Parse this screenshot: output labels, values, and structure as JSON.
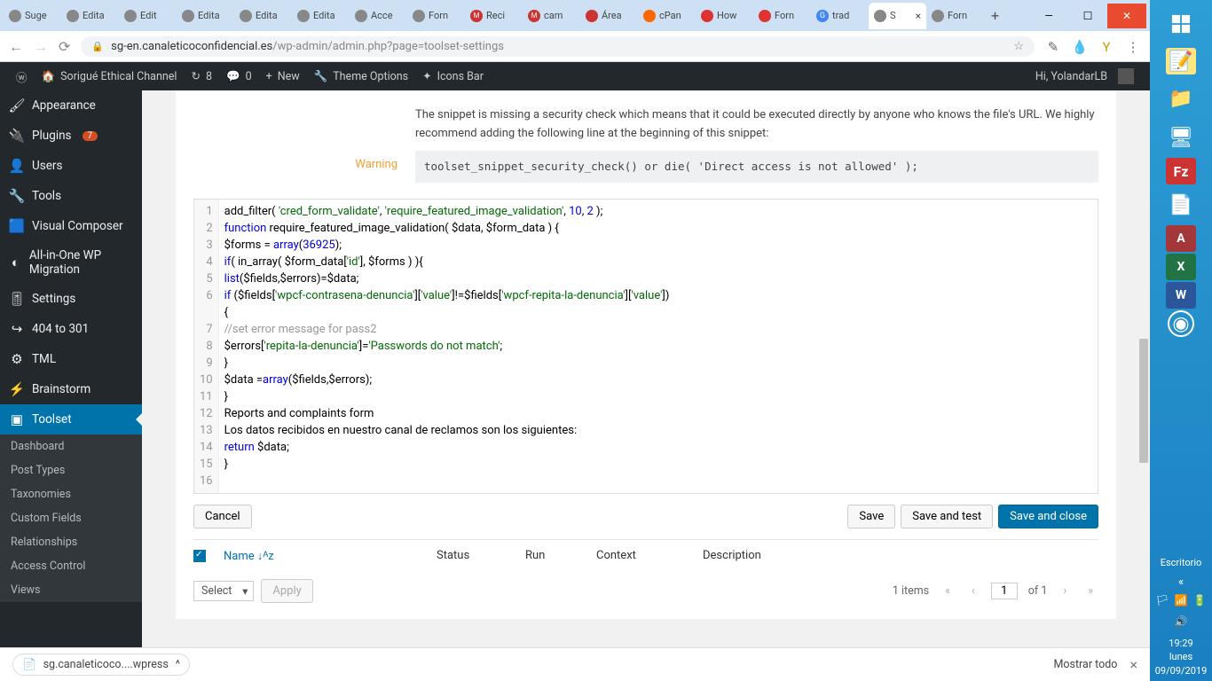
{
  "browser": {
    "tabs": [
      {
        "label": "Suge"
      },
      {
        "label": "Edita"
      },
      {
        "label": "Edit"
      },
      {
        "label": "Edita"
      },
      {
        "label": "Edita"
      },
      {
        "label": "Edita"
      },
      {
        "label": "Acce"
      },
      {
        "label": "Forn"
      },
      {
        "label": "Reci"
      },
      {
        "label": "cam"
      },
      {
        "label": "Área"
      },
      {
        "label": "cPan"
      },
      {
        "label": "How"
      },
      {
        "label": "Forn"
      },
      {
        "label": "trad"
      },
      {
        "label": "S",
        "active": true
      },
      {
        "label": "Forn"
      }
    ],
    "url_host": "sg-en.canaleticoconfidencial.es",
    "url_path": "/wp-admin/admin.php?page=toolset-settings"
  },
  "adminbar": {
    "site": "Sorigué Ethical Channel",
    "updates": "8",
    "comments": "0",
    "new": "New",
    "theme": "Theme Options",
    "icons": "Icons Bar",
    "greeting": "Hi, YolandarLB"
  },
  "menu": {
    "appearance": "Appearance",
    "plugins": "Plugins",
    "plugins_n": "7",
    "users": "Users",
    "tools": "Tools",
    "vc": "Visual Composer",
    "aio": "All-in-One WP Migration",
    "settings": "Settings",
    "r404": "404 to 301",
    "tml": "TML",
    "brain": "Brainstorm",
    "toolset": "Toolset",
    "submenu": [
      "Dashboard",
      "Post Types",
      "Taxonomies",
      "Custom Fields",
      "Relationships",
      "Access Control",
      "Views"
    ]
  },
  "warn": {
    "label": "Warning",
    "text": "The snippet is missing a security check which means that it could be executed directly by anyone who knows the file's URL. We highly recommend adding the following line at the beginning of this snippet:",
    "code": "toolset_snippet_security_check() or die( 'Direct access is not allowed' );"
  },
  "codeLines": [
    "add_filter( 'cred_form_validate', 'require_featured_image_validation', 10, 2 );",
    "function require_featured_image_validation( $data, $form_data ) {",
    "$forms = array(36925);",
    "if( in_array( $form_data['id'], $forms ) ){",
    "list($fields,$errors)=$data;",
    "if ($fields['wpcf-contrasena-denuncia']['value']!=$fields['wpcf-repita-la-denuncia']['value'])",
    "{",
    "//set error message for pass2",
    "$errors['repita-la-denuncia']='Passwords do not match';",
    "}",
    "$data =array($fields,$errors);",
    "}",
    "Reports and complaints form",
    "Los datos recibidos en nuestro canal de reclamos son los siguientes:",
    "return $data;",
    "}"
  ],
  "buttons": {
    "cancel": "Cancel",
    "save": "Save",
    "savetest": "Save and test",
    "saveclose": "Save and close"
  },
  "table": {
    "name": "Name",
    "status": "Status",
    "run": "Run",
    "context": "Context",
    "desc": "Description",
    "sort": "↓ᴬᴢ"
  },
  "bulk": {
    "select": "Select",
    "apply": "Apply",
    "items": "1 items",
    "page": "1",
    "of": "of 1"
  },
  "download": {
    "file": "sg.canaleticoco....wpress",
    "show": "Mostrar todo"
  },
  "taskbar": {
    "desktop": "Escritorio",
    "time": "19:29",
    "day": "lunes",
    "date": "09/09/2019"
  }
}
